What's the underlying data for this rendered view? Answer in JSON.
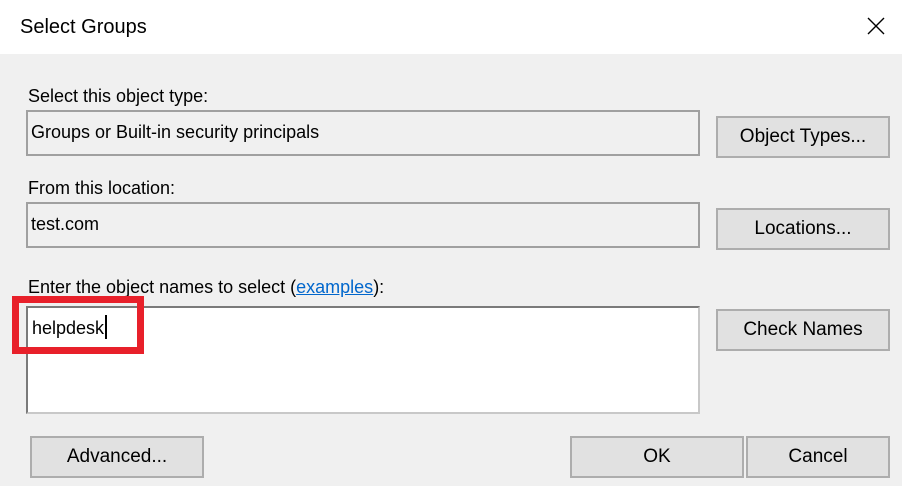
{
  "dialog": {
    "title": "Select Groups"
  },
  "object_type": {
    "label": "Select this object type:",
    "value": "Groups or Built-in security principals",
    "button_label": "Object Types..."
  },
  "location": {
    "label": "From this location:",
    "value": "test.com",
    "button_label": "Locations..."
  },
  "names": {
    "label_prefix": "Enter the object names to select (",
    "link_text": "examples",
    "label_suffix": "):",
    "value": "helpdesk",
    "check_button_label": "Check Names"
  },
  "buttons": {
    "advanced": "Advanced...",
    "ok": "OK",
    "cancel": "Cancel"
  },
  "colors": {
    "highlight": "#e8202a",
    "link": "#0066cc",
    "dialog_background": "#f0f0f0"
  },
  "icons": {
    "close": "close-icon"
  }
}
